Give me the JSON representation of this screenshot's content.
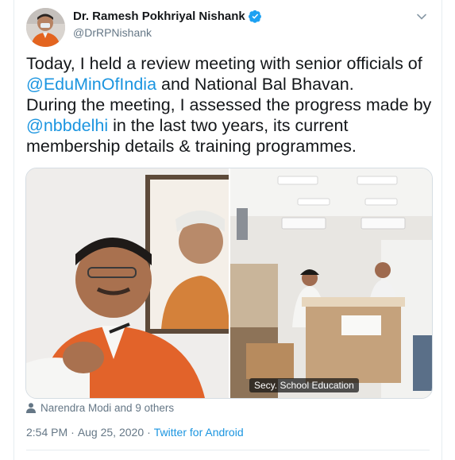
{
  "author": {
    "name": "Dr. Ramesh Pokhriyal Nishank",
    "handle": "@DrRPNishank",
    "verified": true
  },
  "icons": {
    "verified": "verified-badge-icon",
    "menu": "chevron-down-icon",
    "likers": "person-icon"
  },
  "tweet": {
    "line1": "Today, I held a review meeting with senior officials of ",
    "mention1": "@EduMinOfIndia",
    "line1_rest": " and National Bal Bhavan.",
    "line2": "During the meeting, I assessed the progress made by ",
    "mention2": "@nbbdelhi",
    "line2_rest": " in the last two years, its current membership details & training programmes."
  },
  "media": {
    "right_caption": "Secy. School Education"
  },
  "likes": {
    "text": "Narendra Modi and 9 others"
  },
  "meta": {
    "time": "2:54 PM",
    "separator1": "·",
    "date": "Aug 25, 2020",
    "separator2": "·",
    "source": "Twitter for Android"
  },
  "colors": {
    "link": "#1b95e0",
    "secondary_text": "#657786",
    "verified": "#1da1f2"
  }
}
